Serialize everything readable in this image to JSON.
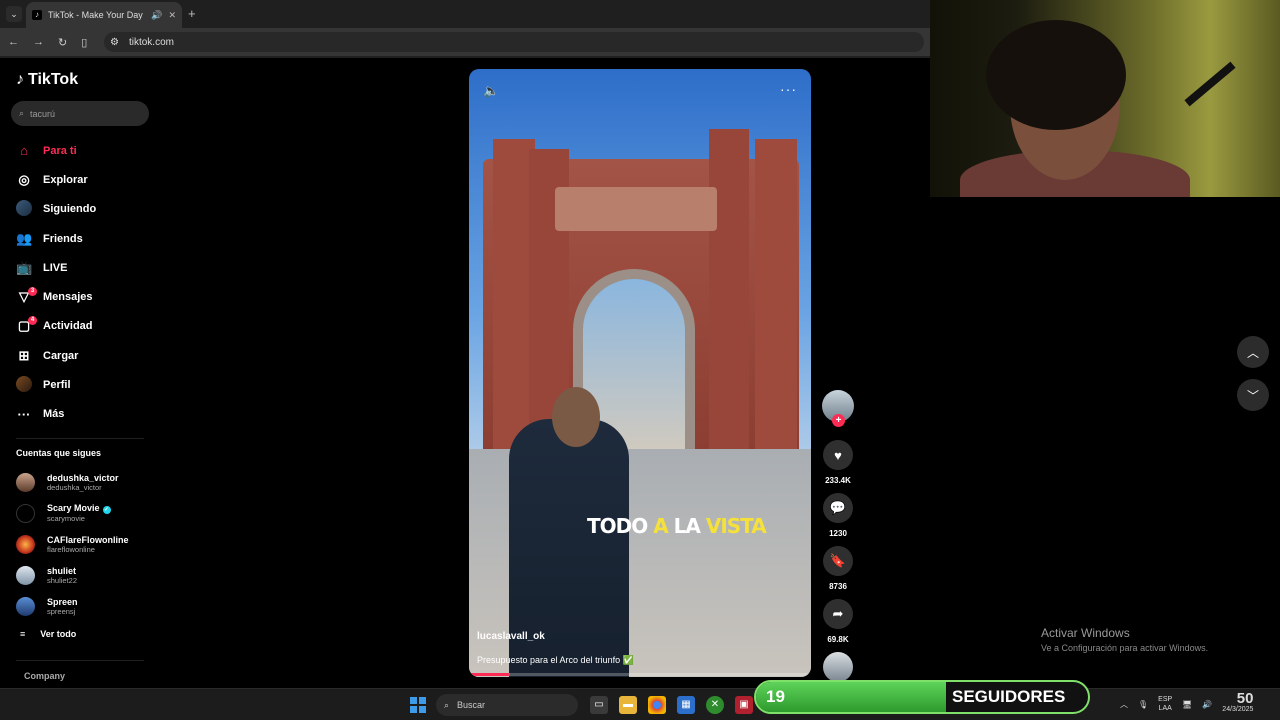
{
  "browser": {
    "tab_title": "TikTok - Make Your Day",
    "url": "tiktok.com"
  },
  "sidebar": {
    "logo": "TikTok",
    "search_placeholder": "tacurú",
    "nav": [
      {
        "label": "Para ti",
        "icon": "home-icon",
        "active": true
      },
      {
        "label": "Explorar",
        "icon": "compass-icon"
      },
      {
        "label": "Siguiendo",
        "icon": "following-avatar"
      },
      {
        "label": "Friends",
        "icon": "friends-icon"
      },
      {
        "label": "LIVE",
        "icon": "live-tv-icon"
      },
      {
        "label": "Mensajes",
        "icon": "messages-icon",
        "badge": "3"
      },
      {
        "label": "Actividad",
        "icon": "activity-icon",
        "badge": "4"
      },
      {
        "label": "Cargar",
        "icon": "upload-icon"
      },
      {
        "label": "Perfil",
        "icon": "profile-avatar"
      },
      {
        "label": "Más",
        "icon": "more-icon"
      }
    ],
    "following_title": "Cuentas que sigues",
    "following": [
      {
        "name": "dedushka_victor",
        "handle": "dedushka_victor",
        "verified": false
      },
      {
        "name": "Scary Movie",
        "handle": "scarymovie",
        "verified": true
      },
      {
        "name": "CAFlareFlowonline",
        "handle": "flareflowonline",
        "verified": false
      },
      {
        "name": "shuliet",
        "handle": "shuliet22",
        "verified": false
      },
      {
        "name": "Spreen",
        "handle": "spreensj",
        "verified": false
      }
    ],
    "see_all": "Ver todo",
    "company": "Company"
  },
  "video": {
    "overlay_text_parts": [
      "TODO ",
      "A",
      " LA ",
      "VISTA"
    ],
    "author": "lucaslavall_ok",
    "description": "Presupuesto para el Arco del triunfo ✅",
    "progress_fraction": 0.12
  },
  "actions": {
    "likes": "233.4K",
    "comments": "1230",
    "saves": "8736",
    "shares": "69.8K"
  },
  "overlay": {
    "activate_title": "Activar Windows",
    "activate_sub": "Ve a Configuración para activar Windows."
  },
  "followers_widget": {
    "count": "19",
    "label": "SEGUIDORES"
  },
  "taskbar": {
    "search_label": "Buscar",
    "lang_top": "ESP",
    "lang_bottom": "LAA",
    "time": "50",
    "date": "24/3/2025"
  },
  "colors": {
    "accent": "#fe2c55",
    "caption_highlight": "#f5e13a",
    "followers_green": "#5ed35a"
  }
}
